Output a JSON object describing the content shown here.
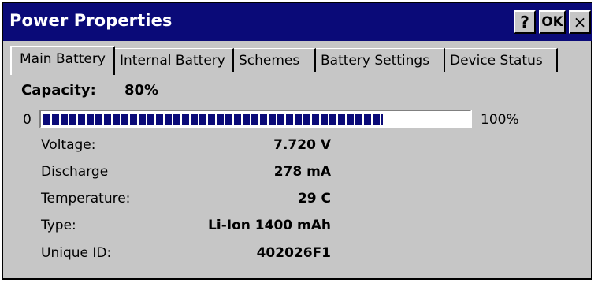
{
  "window": {
    "title": "Power Properties",
    "buttons": {
      "help": "?",
      "ok": "OK",
      "close": "×"
    }
  },
  "tabs": [
    {
      "label": "Main Battery",
      "active": true
    },
    {
      "label": "Internal Battery",
      "active": false
    },
    {
      "label": "Schemes",
      "active": false
    },
    {
      "label": "Battery Settings",
      "active": false
    },
    {
      "label": "Device Status",
      "active": false
    }
  ],
  "battery": {
    "capacity_label": "Capacity:",
    "capacity_value": "80%",
    "capacity_fraction": 0.8,
    "bar_min": "0",
    "bar_max": "100%",
    "rows": [
      {
        "label": "Voltage:",
        "value": "7.720 V"
      },
      {
        "label": "Discharge",
        "value": "278 mA"
      },
      {
        "label": "Temperature:",
        "value": "29 C"
      },
      {
        "label": "Type:",
        "value": "Li-Ion 1400 mAh"
      },
      {
        "label": "Unique ID:",
        "value": "402026F1"
      }
    ]
  },
  "colors": {
    "titlebar": "#0a0a78",
    "window_bg": "#c6c6c6",
    "progress": "#0a0a78"
  }
}
